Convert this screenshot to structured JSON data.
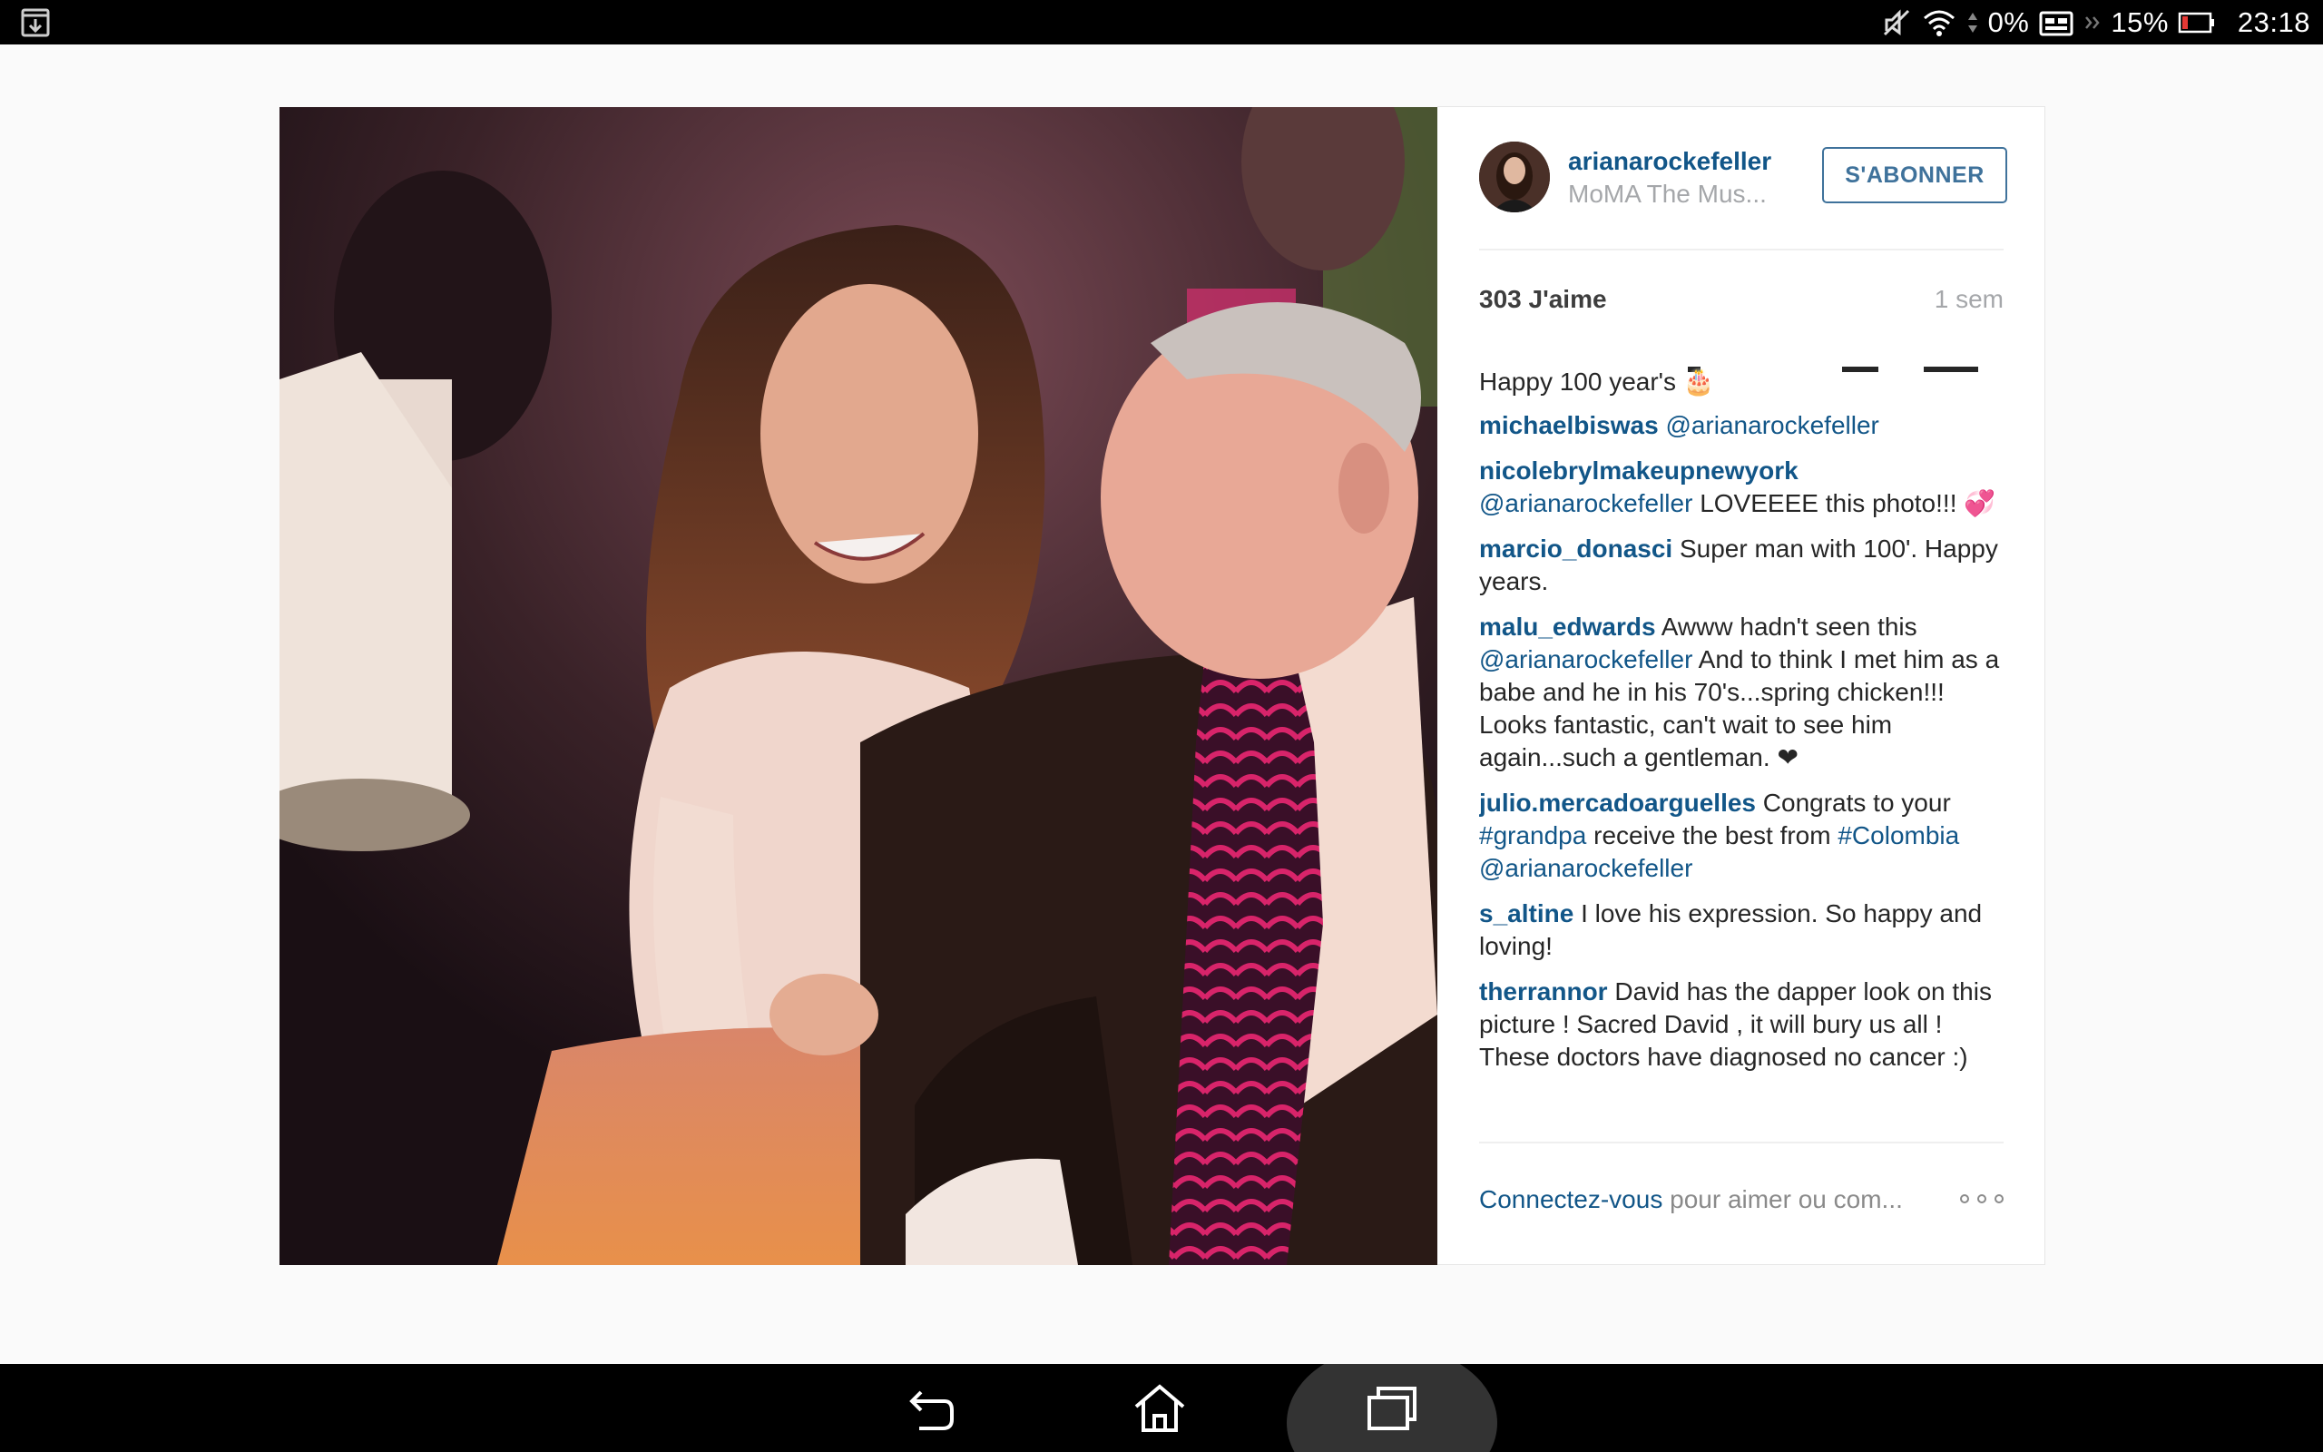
{
  "status_bar": {
    "icons": [
      "download-notification-icon",
      "mute-icon",
      "wifi-icon",
      "data-arrows-icon",
      "cpu-usage-icon",
      "overflow-icon",
      "battery-icon"
    ],
    "cpu_label": "0%",
    "battery_label": "15%",
    "time": "23:18"
  },
  "post": {
    "username": "arianarockefeller",
    "location": "MoMA The Mus...",
    "follow_label": "S'ABONNER",
    "likes": "303 J'aime",
    "time_ago": "1 sem",
    "caption_tail": "Happy 100 year's 🎂",
    "comments": [
      {
        "user": "michaelbiswas",
        "parts": [
          {
            "t": "mention",
            "v": "@arianarockefeller"
          }
        ]
      },
      {
        "user": "nicolebrylmakeupnewyork",
        "parts": [
          {
            "t": "mention",
            "v": "@arianarockefeller"
          },
          {
            "t": "text",
            "v": " LOVEEEE this photo!!! 💞"
          }
        ]
      },
      {
        "user": "marcio_donasci",
        "parts": [
          {
            "t": "text",
            "v": "Super man with 100'. Happy years."
          }
        ]
      },
      {
        "user": "malu_edwards",
        "parts": [
          {
            "t": "text",
            "v": "Awww hadn't seen this "
          },
          {
            "t": "mention",
            "v": "@arianarockefeller"
          },
          {
            "t": "text",
            "v": " And to think I met him as a babe and he in his 70's...spring chicken!!! Looks fantastic, can't wait to see him again...such a gentleman. ❤"
          }
        ]
      },
      {
        "user": "julio.mercadoarguelles",
        "parts": [
          {
            "t": "text",
            "v": "Congrats to your "
          },
          {
            "t": "mention",
            "v": "#grandpa"
          },
          {
            "t": "text",
            "v": " receive the best from "
          },
          {
            "t": "mention",
            "v": "#Colombia"
          },
          {
            "t": "text",
            "v": " "
          },
          {
            "t": "mention",
            "v": "@arianarockefeller"
          }
        ]
      },
      {
        "user": "s_altine",
        "parts": [
          {
            "t": "text",
            "v": "I love his expression. So happy and loving!"
          }
        ]
      },
      {
        "user": "therrannor",
        "parts": [
          {
            "t": "text",
            "v": "David has the dapper look on this picture ! Sacred David , it will bury us all ! These doctors have diagnosed no cancer :)"
          }
        ]
      }
    ],
    "login_link": "Connectez-vous",
    "login_rest": " pour aimer ou com...",
    "more_icon": "more-options-icon"
  },
  "nav_bar": {
    "icons": [
      "back-icon",
      "home-icon",
      "recents-icon"
    ]
  }
}
